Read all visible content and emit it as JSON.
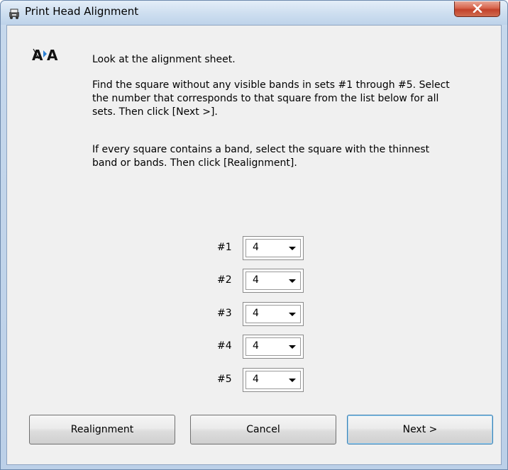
{
  "window": {
    "title": "Print Head Alignment",
    "icon": "printer-alignment-icon",
    "close_icon": "close-icon"
  },
  "instructions": {
    "line1": "Look at the alignment sheet.",
    "para2_line1": "Find the square without any visible bands in sets #1 through #5. Select",
    "para2_line2": "the number that corresponds to that square from the list below for all",
    "para2_line3": "sets. Then click [Next >].",
    "para3_line1": "If every square contains a band, select the square with the thinnest",
    "para3_line2": "band or bands. Then click [Realignment]."
  },
  "sets": [
    {
      "label": "#1",
      "value": "4"
    },
    {
      "label": "#2",
      "value": "4"
    },
    {
      "label": "#3",
      "value": "4"
    },
    {
      "label": "#4",
      "value": "4"
    },
    {
      "label": "#5",
      "value": "4"
    }
  ],
  "buttons": {
    "realignment": "Realignment",
    "cancel": "Cancel",
    "next": "Next >"
  },
  "colors": {
    "accent_blue": "#2a7fd4",
    "close_red": "#c2422a"
  }
}
